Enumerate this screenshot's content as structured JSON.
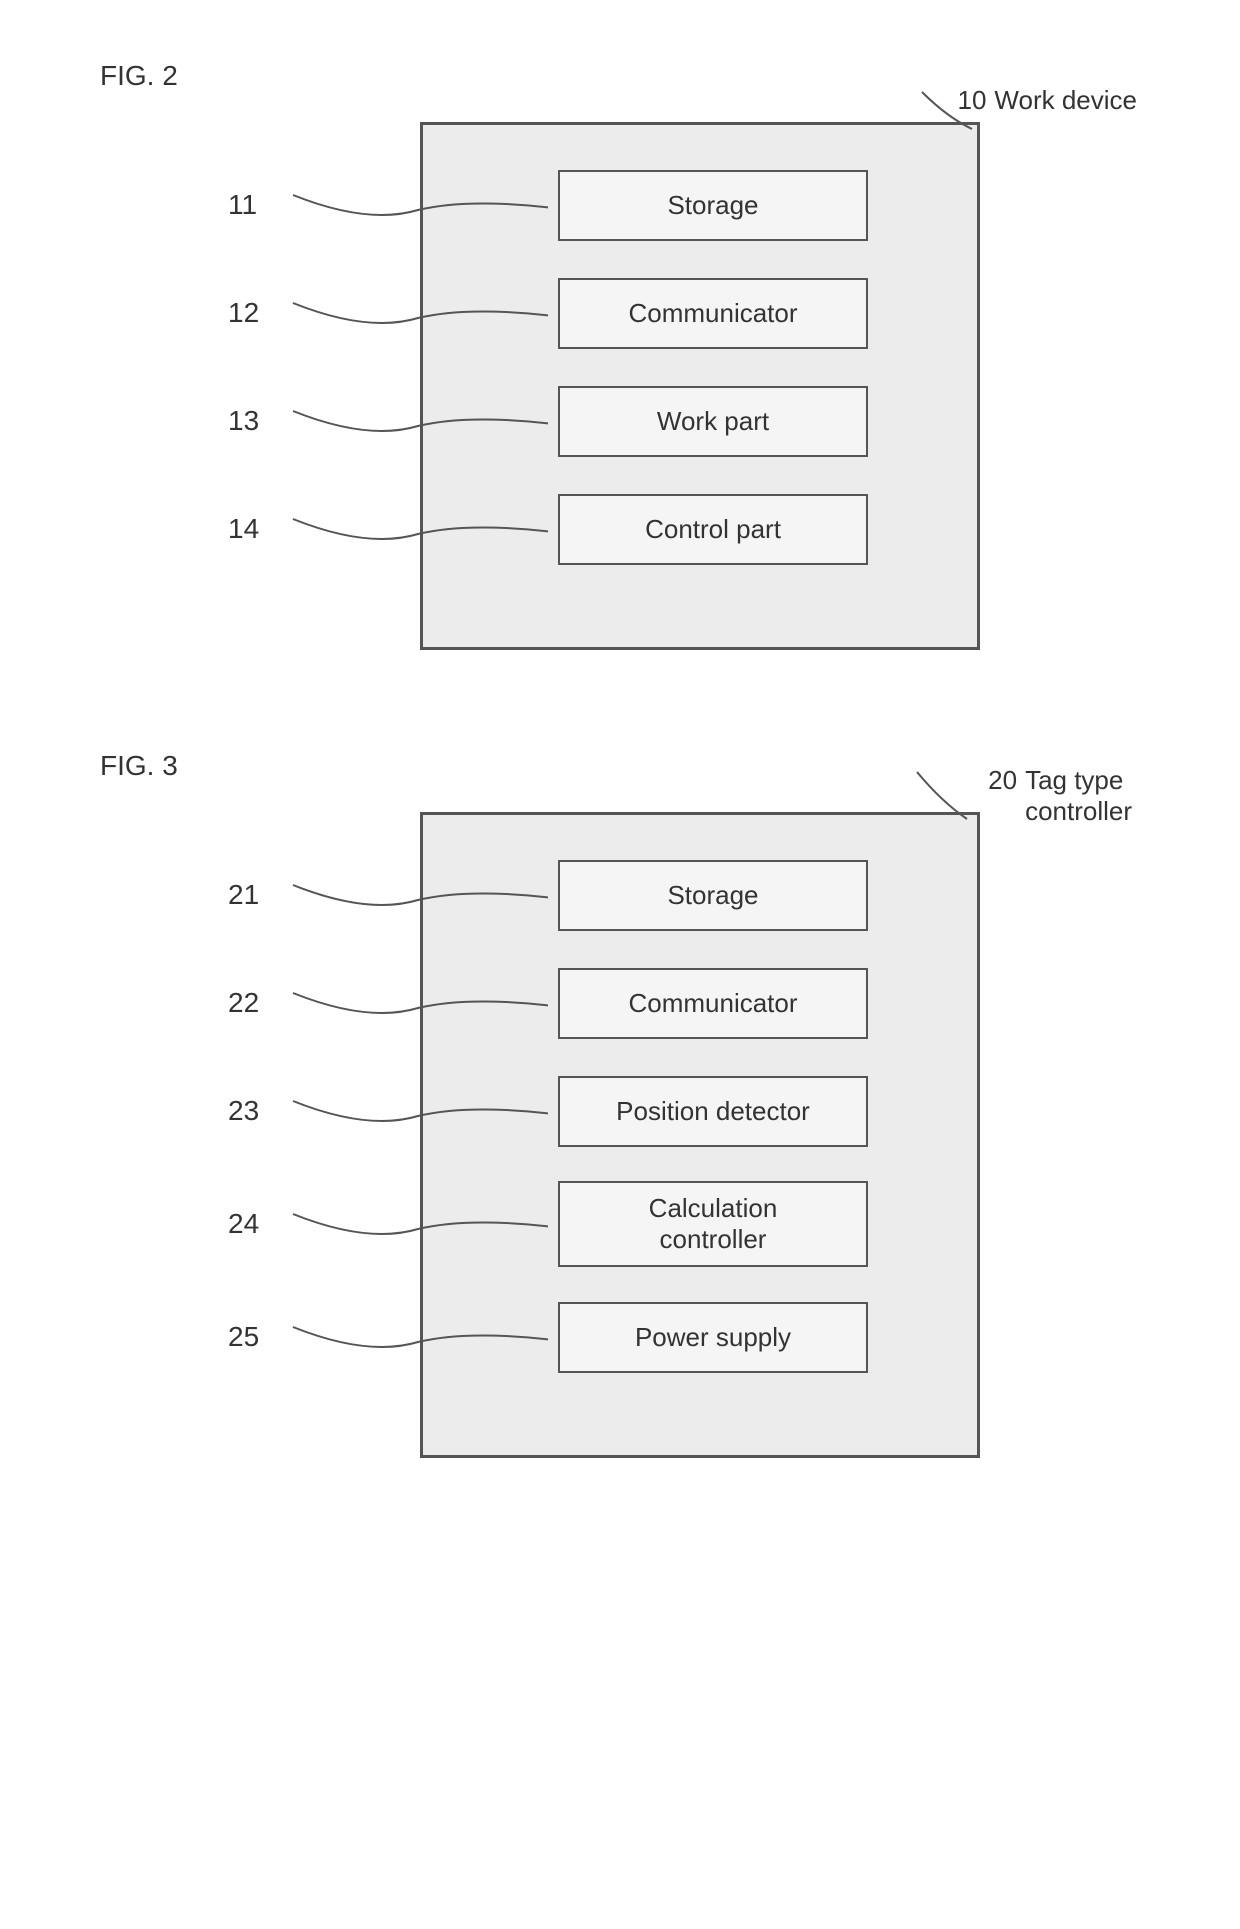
{
  "fig2": {
    "label": "FIG. 2",
    "main_num": "10",
    "main_text": "Work device",
    "components": [
      {
        "num": "11",
        "label": "Storage"
      },
      {
        "num": "12",
        "label": "Communicator"
      },
      {
        "num": "13",
        "label": "Work part"
      },
      {
        "num": "14",
        "label": "Control part"
      }
    ]
  },
  "fig3": {
    "label": "FIG. 3",
    "main_num": "20",
    "main_text": "Tag type\ncontroller",
    "components": [
      {
        "num": "21",
        "label": "Storage"
      },
      {
        "num": "22",
        "label": "Communicator"
      },
      {
        "num": "23",
        "label": "Position detector"
      },
      {
        "num": "24",
        "label": "Calculation\ncontroller"
      },
      {
        "num": "25",
        "label": "Power supply"
      }
    ]
  }
}
